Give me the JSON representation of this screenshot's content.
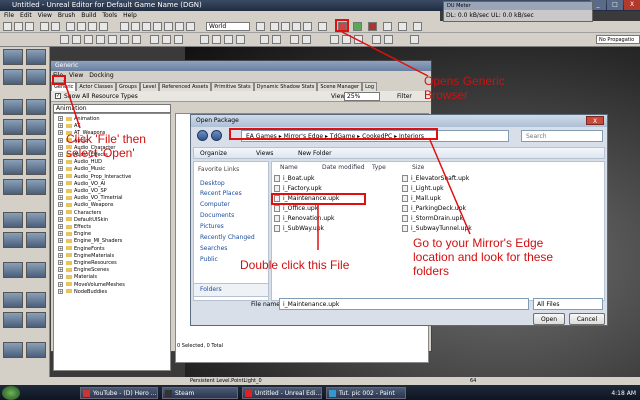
{
  "window": {
    "title": "Untitled - Unreal Editor for Default Game Name (DGN)",
    "min": "_",
    "max": "□",
    "close": "X"
  },
  "menubar": {
    "items": [
      "File",
      "Edit",
      "View",
      "Brush",
      "Build",
      "Tools",
      "Help"
    ]
  },
  "toolbar": {
    "world_dropdown": "World",
    "no_propagation": "No Propagatio"
  },
  "du_meter": {
    "title": "DU Meter",
    "text": "DL: 0.0 kB/sec  UL: 0.0 kB/sec"
  },
  "generic_browser": {
    "title": "Generic",
    "menu": [
      "File",
      "View",
      "Docking"
    ],
    "tabs": [
      "Generic",
      "Actor Classes",
      "Groups",
      "Level",
      "Referenced Assets",
      "Primitive Stats",
      "Dynamic Shadow Stats",
      "Scene Manager",
      "Log"
    ],
    "show_all": "Show All Resource Types",
    "type_dropdown": "Animation",
    "view_label": "View",
    "zoom": "25%",
    "filter_label": "Filter",
    "tree": [
      "Animation",
      "AT",
      "AT_Weapons",
      "Audio",
      "Audio_Character",
      "Audio_Effects",
      "Audio_HUD",
      "Audio_Music",
      "Audio_Prop_Interactive",
      "Audio_VO_AI",
      "Audio_VO_SP",
      "Audio_VO_Timetrial",
      "Audio_Weapons",
      "Characters",
      "DefaultUISkin",
      "Effects",
      "Engine",
      "Engine_MI_Shaders",
      "EngineFonts",
      "EngineMaterials",
      "EngineResources",
      "EngineScenes",
      "Materials",
      "MoveVolumeMeshes",
      "NodeBuddies"
    ],
    "status": "0 Selected, 0 Total"
  },
  "open_package": {
    "title": "Open Package",
    "close": "X",
    "breadcrumb": [
      "EA Games",
      "Mirror's Edge",
      "TdGame",
      "CookedPC",
      "Interiors"
    ],
    "search_placeholder": "Search",
    "organize": "Organize",
    "views": "Views",
    "new_folder": "New Folder",
    "favorite_links": "Favorite Links",
    "favorites": [
      "Desktop",
      "Recent Places",
      "Computer",
      "Documents",
      "Pictures",
      "Recently Changed",
      "Searches",
      "Public"
    ],
    "folders": "Folders",
    "columns": [
      "Name",
      "Date modified",
      "Type",
      "Size"
    ],
    "files_col1": [
      "i_Boat.upk",
      "i_Factory.upk",
      "i_Maintenance.upk",
      "i_Office.upk",
      "i_Renovation.upk",
      "i_SubWay.upk"
    ],
    "files_col2": [
      "i_ElevatorShaft.upk",
      "i_Light.upk",
      "i_Mall.upk",
      "i_ParkingDeck.upk",
      "i_StormDrain.upk",
      "i_SubwayTunnel.upk"
    ],
    "file_name_label": "File name:",
    "file_name_value": "i_Maintenance.upk",
    "filter_value": "All Files",
    "open_button": "Open",
    "cancel_button": "Cancel"
  },
  "annotations": {
    "generic_browser": "Opens Generic\nBrowser",
    "file_open": "Click 'File' then\nselect 'Open'",
    "double_click": "Double click this File",
    "mirrors_edge": "Go to your Mirror's Edge\nlocation and look for these\nfolders"
  },
  "statusbar": {
    "text": "Persistent Level.PointLight_0",
    "zoom": "64"
  },
  "taskbar": {
    "tasks": [
      "YouTube - (D) Hero ...",
      "Steam",
      "Untitled - Unreal Edi...",
      "Tut. pic 002 - Paint"
    ],
    "time": "4:18 AM"
  },
  "colors": {
    "annotation": "#d01010",
    "titlebar": "#1f2c40"
  }
}
